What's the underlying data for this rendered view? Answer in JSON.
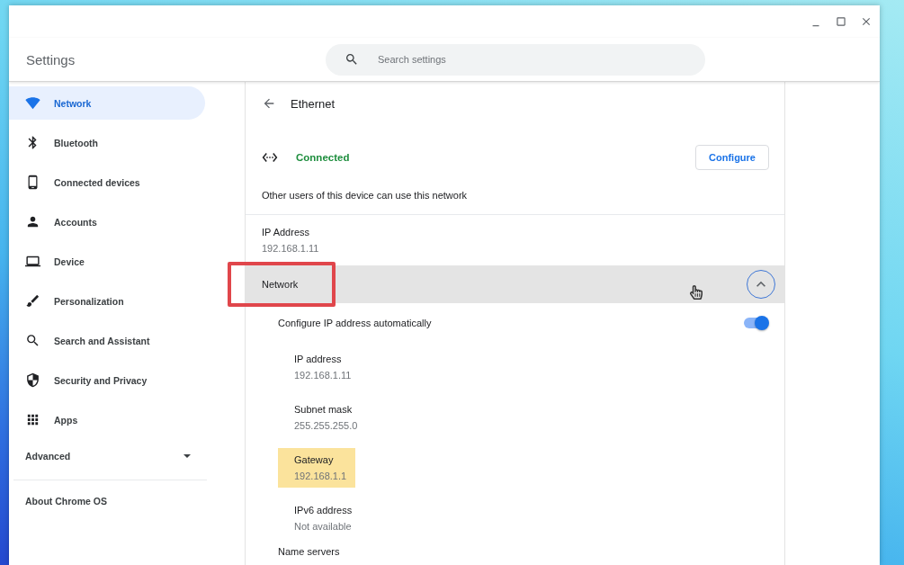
{
  "window": {
    "title": "Settings"
  },
  "search": {
    "placeholder": "Search settings"
  },
  "sidebar": {
    "items": [
      {
        "label": "Network",
        "selected": true
      },
      {
        "label": "Bluetooth",
        "selected": false
      },
      {
        "label": "Connected devices",
        "selected": false
      },
      {
        "label": "Accounts",
        "selected": false
      },
      {
        "label": "Device",
        "selected": false
      },
      {
        "label": "Personalization",
        "selected": false
      },
      {
        "label": "Search and Assistant",
        "selected": false
      },
      {
        "label": "Security and Privacy",
        "selected": false
      },
      {
        "label": "Apps",
        "selected": false
      }
    ],
    "advanced": {
      "label": "Advanced",
      "expanded": false
    },
    "about": {
      "label": "About Chrome OS"
    }
  },
  "detail": {
    "title": "Ethernet",
    "status": "Connected",
    "configure_button": "Configure",
    "sharing_note": "Other users of this device can use this network",
    "ip_address": {
      "label": "IP Address",
      "value": "192.168.1.11"
    },
    "network_section": {
      "label": "Network",
      "hovered": true,
      "outlined": true,
      "expanded": true,
      "auto_config": {
        "label": "Configure IP address automatically",
        "on": true
      },
      "fields": [
        {
          "label": "IP address",
          "value": "192.168.1.11",
          "highlighted": false
        },
        {
          "label": "Subnet mask",
          "value": "255.255.255.0",
          "highlighted": false
        },
        {
          "label": "Gateway",
          "value": "192.168.1.1",
          "highlighted": true
        },
        {
          "label": "IPv6 address",
          "value": "Not available",
          "highlighted": false
        }
      ],
      "name_servers_label": "Name servers"
    }
  }
}
